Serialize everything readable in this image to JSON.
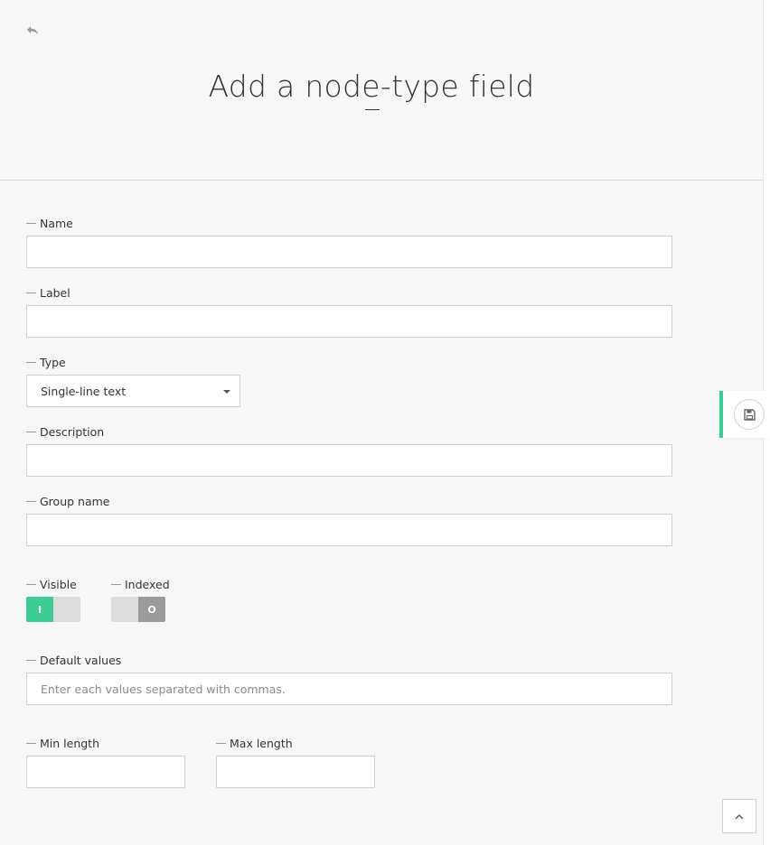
{
  "header": {
    "title": "Add a node-type field",
    "back_icon": "undo-arrow-icon"
  },
  "form": {
    "name_label": "Name",
    "label_label": "Label",
    "type_label": "Type",
    "type_value": "Single-line text",
    "description_label": "Description",
    "group_label": "Group name",
    "visible_label": "Visible",
    "visible_toggle_text": "I",
    "visible_on": true,
    "indexed_label": "Indexed",
    "indexed_toggle_text": "O",
    "indexed_on": false,
    "default_values_label": "Default values",
    "default_values_placeholder": "Enter each values separated with commas.",
    "min_length_label": "Min length",
    "max_length_label": "Max length"
  },
  "actions": {
    "save_icon": "floppy-disk-icon",
    "scroll_top_icon": "chevron-up-icon"
  },
  "colors": {
    "accent": "#3ecc96",
    "background": "#f7f7f7",
    "border": "#d1d1d1",
    "toggle_off": "#9a9a9a"
  }
}
